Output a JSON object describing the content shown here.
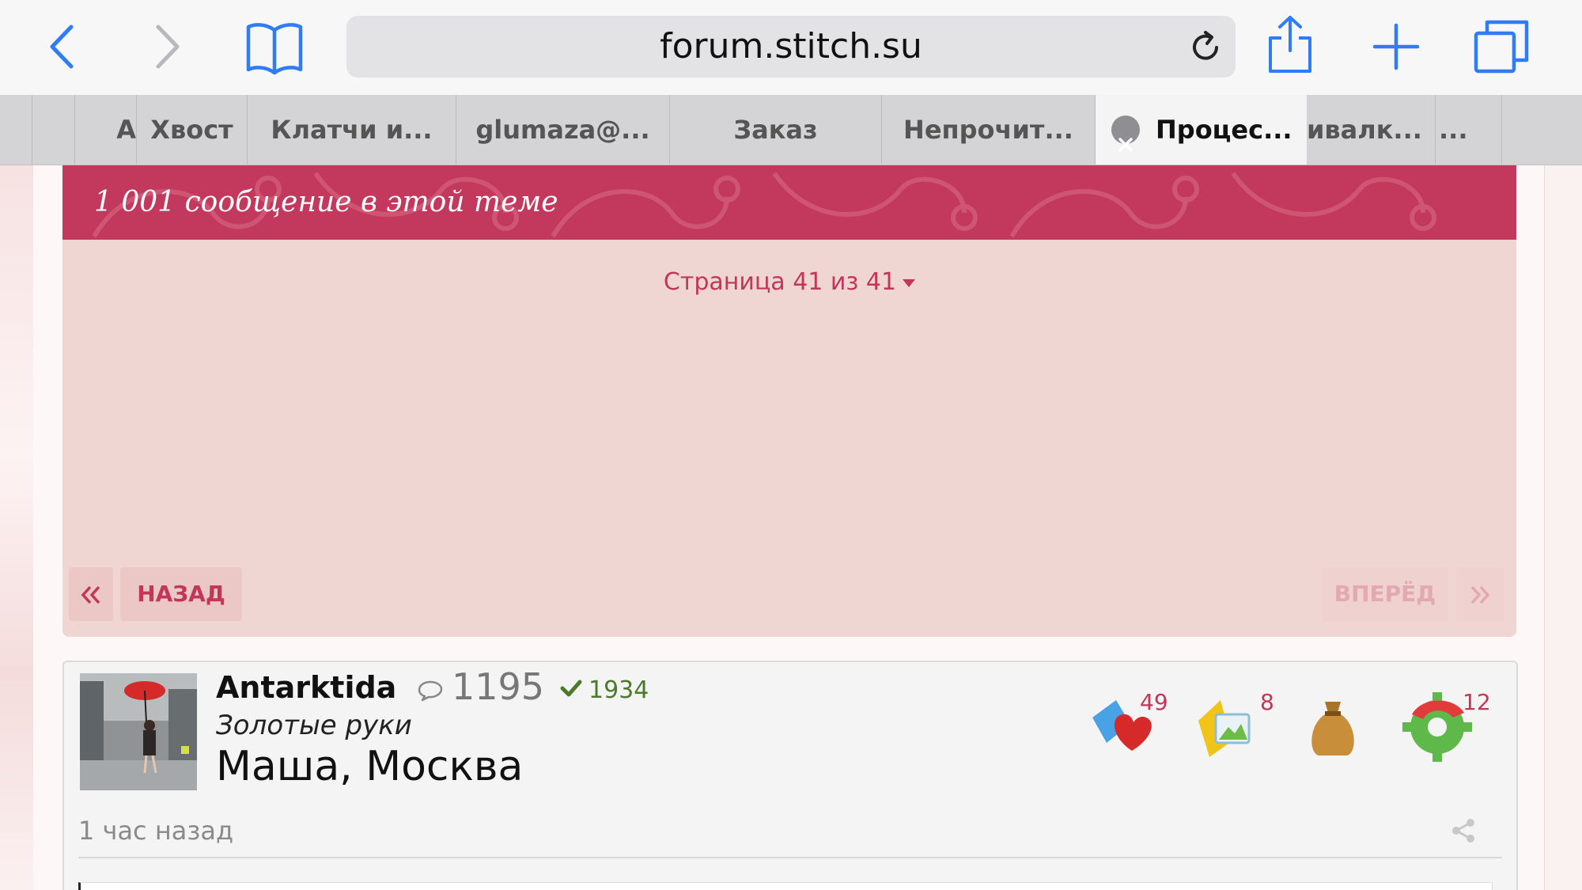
{
  "browser": {
    "url": "forum.stitch.su",
    "tabs": [
      {
        "label": "А"
      },
      {
        "label": "Хвост"
      },
      {
        "label": "Клатчи и..."
      },
      {
        "label": "glumaza@..."
      },
      {
        "label": "Заказ"
      },
      {
        "label": "Непрочит..."
      },
      {
        "label": "Процес...",
        "active": true
      },
      {
        "label": "ивалк..."
      },
      {
        "label": "..."
      }
    ]
  },
  "topic": {
    "banner_text": "1 001 сообщение в этой теме",
    "pagination": {
      "current": "Страница 41 из 41",
      "back_label": "НАЗАД",
      "forward_label": "ВПЕРЁД"
    }
  },
  "post": {
    "username": "Antarktida",
    "post_count": "1195",
    "reputation": "1934",
    "rank": "Золотые руки",
    "location": "Маша, Москва",
    "time": "1 час назад",
    "badges": [
      {
        "icon": "heart-folder-icon",
        "count": "49"
      },
      {
        "icon": "photo-folder-icon",
        "count": "8"
      },
      {
        "icon": "money-bag-icon",
        "count": ""
      },
      {
        "icon": "gear-icon",
        "count": "12"
      }
    ]
  },
  "colors": {
    "accent": "#c2365a",
    "banner": "#c3395d",
    "link_blue": "#2f7cf6"
  }
}
